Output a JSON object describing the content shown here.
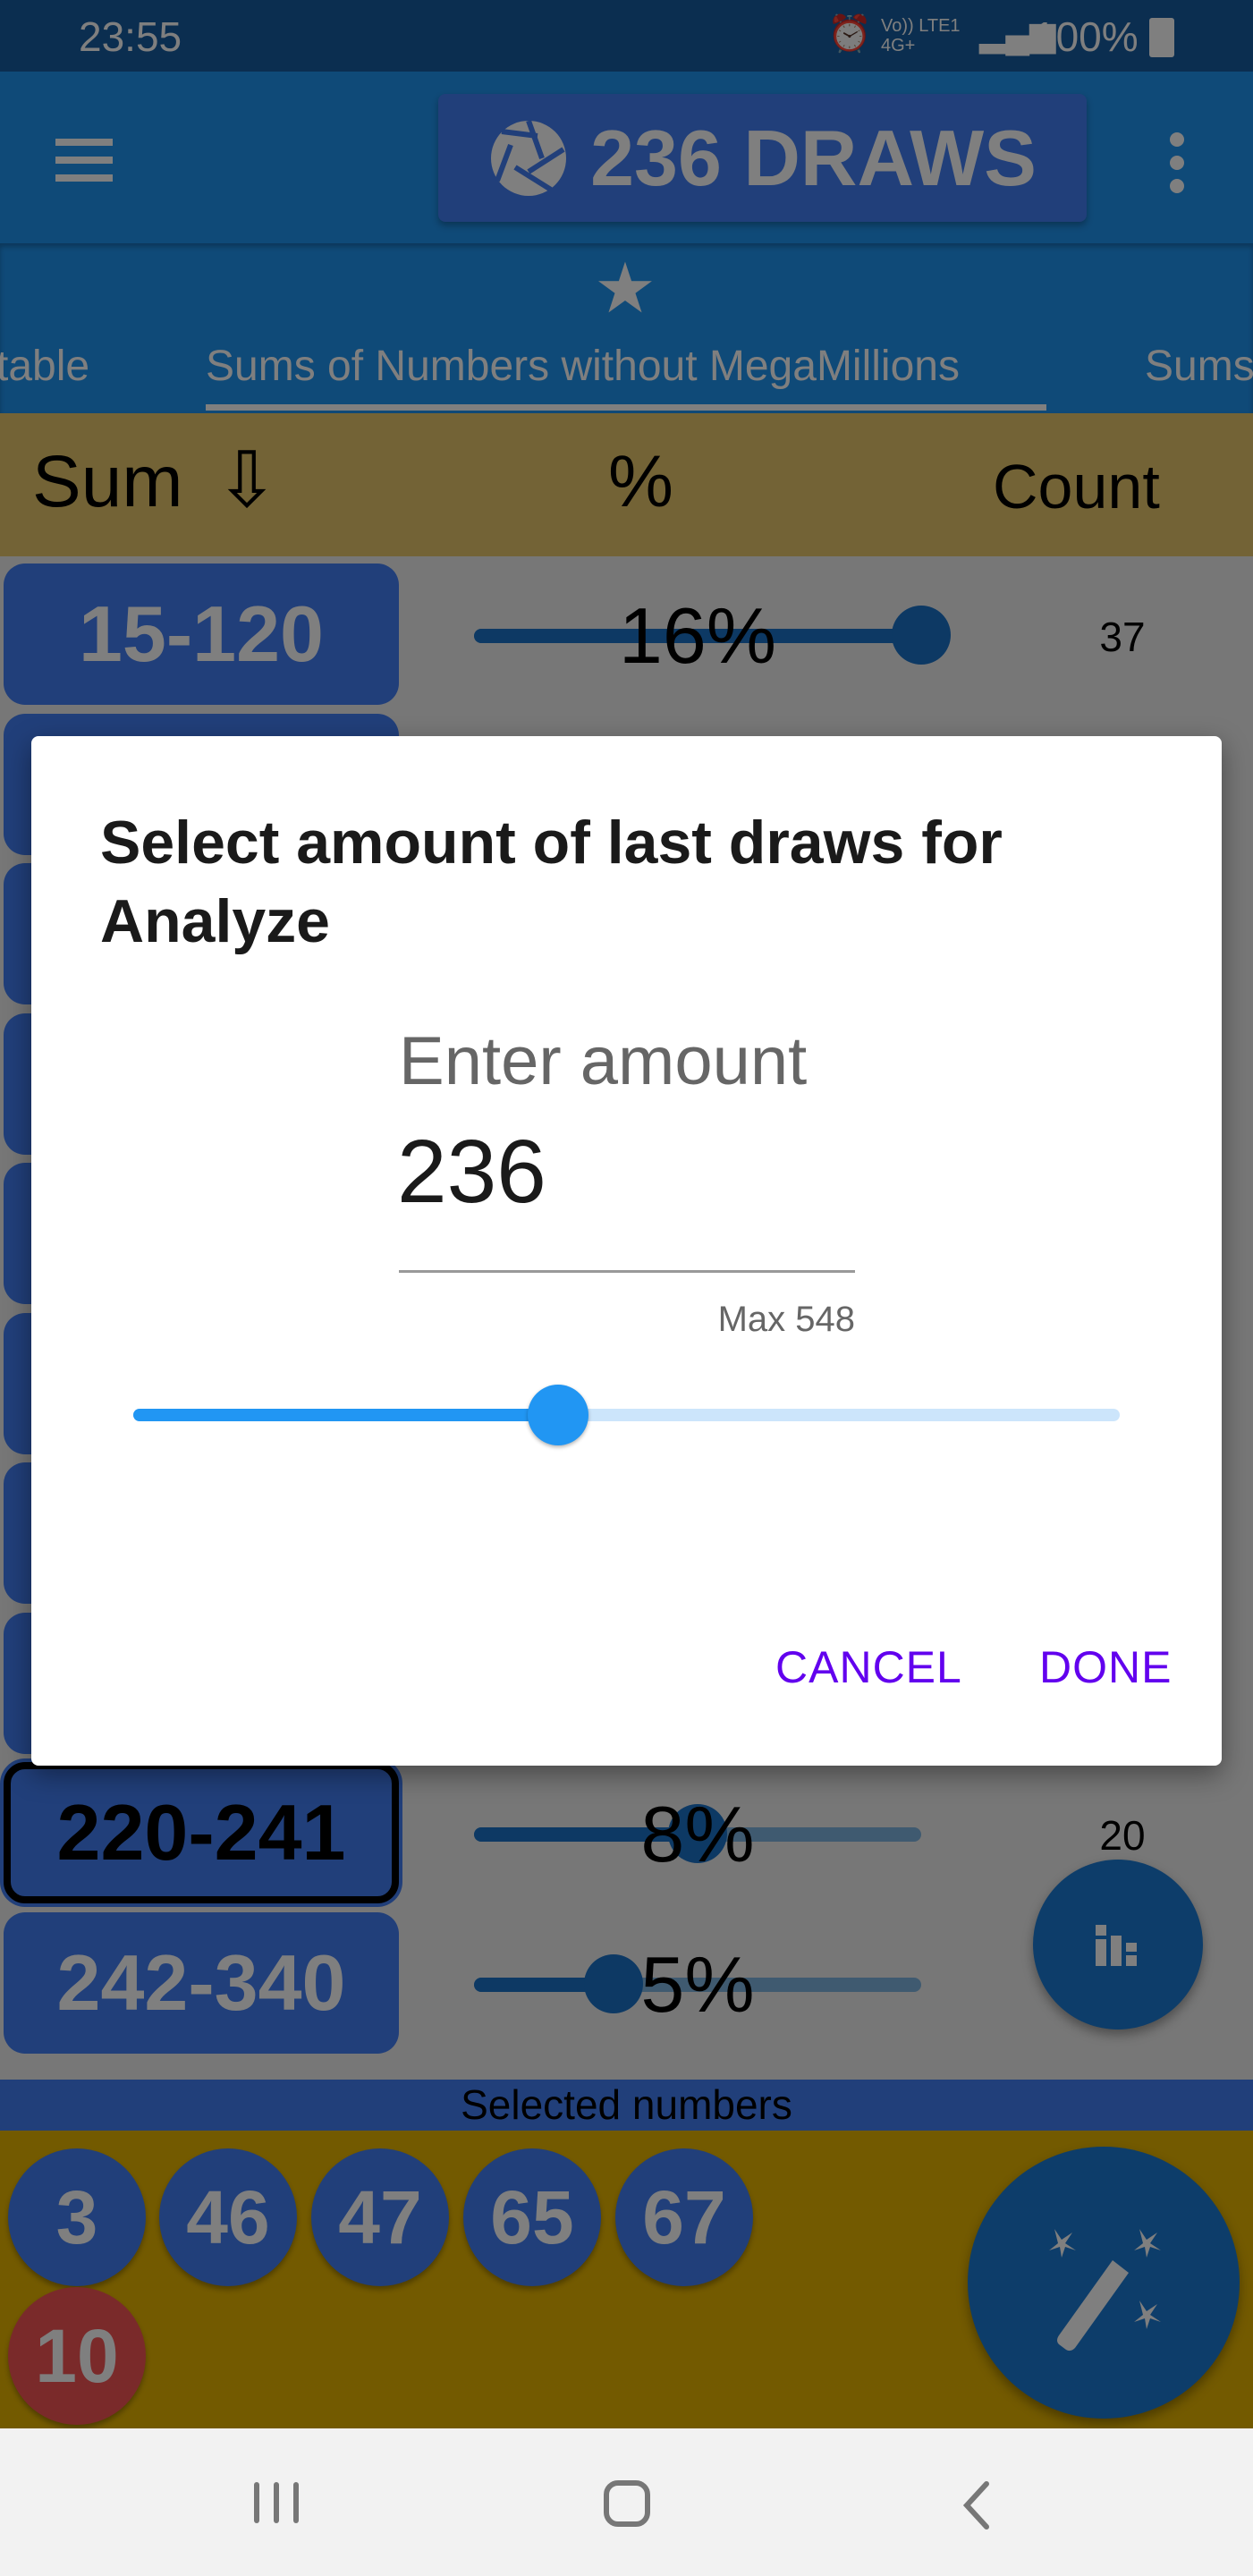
{
  "status_bar": {
    "time": "23:55",
    "network": "Vo)) LTE1 4G+",
    "battery": "100%"
  },
  "app_bar": {
    "title": "236 DRAWS",
    "menu_icon": "hamburger-icon",
    "more_icon": "more-vert-icon",
    "title_icon": "aperture-icon"
  },
  "tabs": [
    {
      "label": "table"
    },
    {
      "label": "Sums of Numbers without MegaMillions",
      "active": true
    },
    {
      "label": "Sums"
    }
  ],
  "table_header": {
    "sum": "Sum",
    "sort_icon": "arrow-down-icon",
    "percent": "%",
    "count": "Count"
  },
  "rows": [
    {
      "range": "15-120",
      "percent_label": "16%",
      "percent": 16,
      "count": "37"
    },
    {
      "range": ""
    },
    {
      "range": ""
    },
    {
      "range": ""
    },
    {
      "range": ""
    },
    {
      "range": ""
    },
    {
      "range": ""
    },
    {
      "range": ""
    },
    {
      "range": "220-241",
      "percent_label": "8%",
      "percent": 8,
      "count": "20",
      "selected": true
    },
    {
      "range": "242-340",
      "percent_label": "5%",
      "percent": 5,
      "count": ""
    }
  ],
  "selected": {
    "label": "Selected numbers",
    "numbers": [
      "3",
      "46",
      "47",
      "65",
      "67"
    ],
    "mega": "10"
  },
  "dialog": {
    "title": "Select amount of last draws for Analyze",
    "field_label": "Enter amount",
    "field_value": "236",
    "max_label": "Max 548",
    "slider": {
      "value": 236,
      "max": 548
    },
    "cancel": "CANCEL",
    "done": "DONE"
  },
  "colors": {
    "primary": "#1f94f0",
    "button": "#427ef4",
    "accent": "#6200ee",
    "slider": "#2196f3",
    "header": "#e6c66c",
    "selection": "#e6b400",
    "mega": "#f45454"
  }
}
